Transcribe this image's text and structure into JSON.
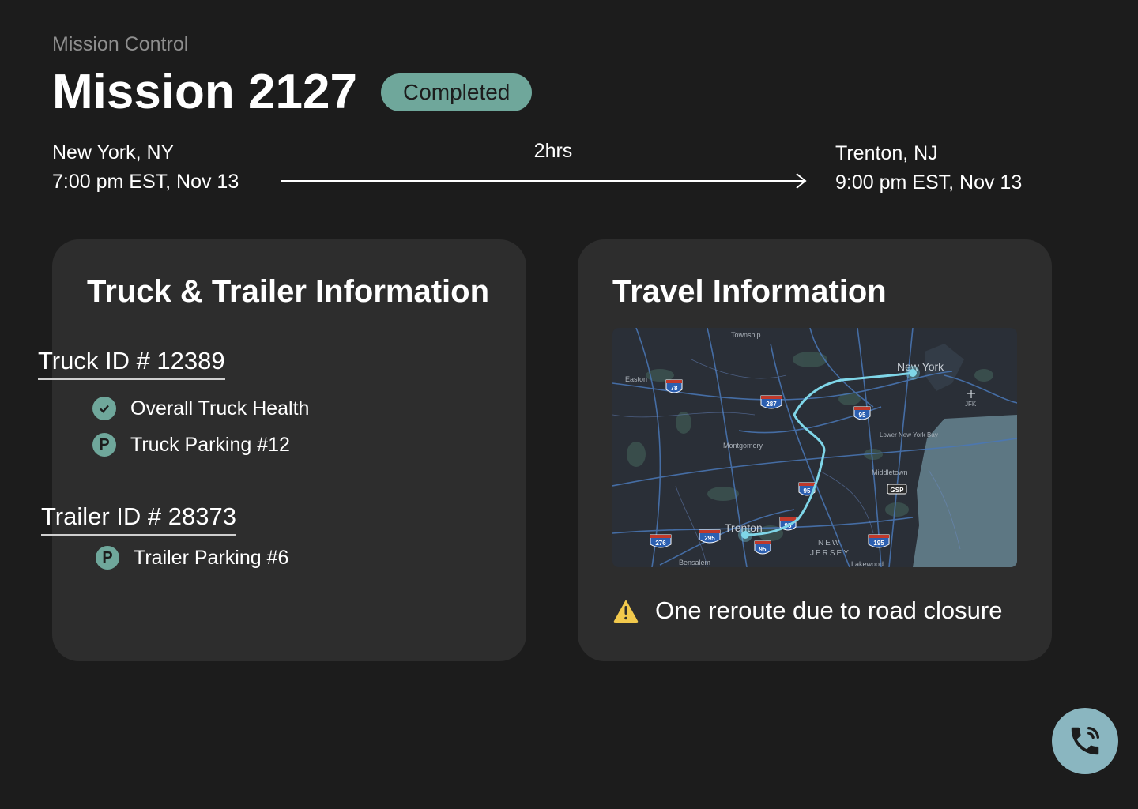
{
  "header": {
    "eyebrow": "Mission Control",
    "title": "Mission 2127",
    "status": "Completed",
    "status_color": "#6fa79b"
  },
  "route": {
    "origin": {
      "city": "New York, NY",
      "time": "7:00 pm EST, Nov 13"
    },
    "destination": {
      "city": "Trenton, NJ",
      "time": "9:00 pm EST, Nov 13"
    },
    "duration": "2hrs"
  },
  "truck_card": {
    "title": "Truck & Trailer Information",
    "truck_id": "Truck ID # 12389",
    "truck_items": [
      {
        "icon": "check-circle-icon",
        "label": "Overall Truck Health"
      },
      {
        "icon": "parking-icon",
        "label": "Truck Parking #12"
      }
    ],
    "trailer_id": "Trailer ID # 28373",
    "trailer_items": [
      {
        "icon": "parking-icon",
        "label": "Trailer Parking #6"
      }
    ]
  },
  "travel_card": {
    "title": "Travel Information",
    "map": {
      "places": [
        "New York",
        "JFK",
        "Easton",
        "Township",
        "Montgomery",
        "Lower New York Bay",
        "Middletown",
        "Trenton",
        "NEW",
        "JERSEY",
        "Bensalem",
        "Lakewood"
      ],
      "shields": [
        "78",
        "287",
        "95",
        "95",
        "95",
        "295",
        "276",
        "95",
        "195",
        "GSP"
      ],
      "route_color": "#7fd6e8"
    },
    "alert": "One reroute due to road closure",
    "alert_color": "#f2c94c"
  },
  "actions": {
    "call_icon": "phone-icon"
  },
  "colors": {
    "background": "#1c1c1c",
    "card": "#2d2d2d",
    "accent": "#6fa79b",
    "call": "#8ab6c0"
  }
}
